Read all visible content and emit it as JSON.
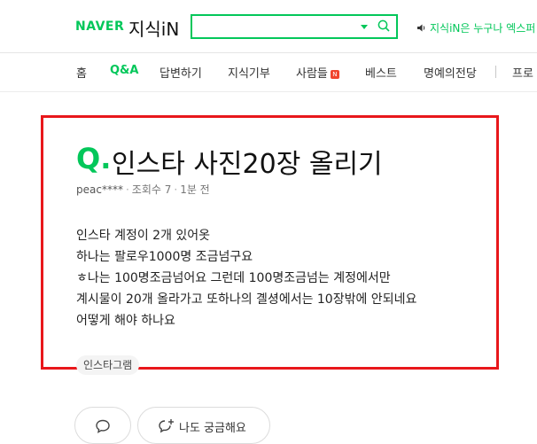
{
  "header": {
    "logo_brand": "NAVER",
    "logo_service": "지식iN",
    "search_placeholder": "",
    "notice_highlight": "지식iN은 누구나 엑스퍼",
    "notice_rest": "",
    "brand_color": "#03c75a"
  },
  "nav": {
    "items": [
      {
        "label": "홈"
      },
      {
        "label": "Q&A",
        "active": true
      },
      {
        "label": "답변하기"
      },
      {
        "label": "지식기부"
      },
      {
        "label": "사람들",
        "badge": "N"
      },
      {
        "label": "베스트"
      },
      {
        "label": "명예의전당"
      },
      {
        "label": "프로"
      }
    ]
  },
  "question": {
    "q_mark": "Q.",
    "title": "인스타 사진20장 올리기",
    "author": "peac****",
    "views": "조회수 7",
    "time": "1분 전",
    "body": [
      "인스타 계정이 2개 있어옷",
      "하나는 팔로우1000명 조금넘구요",
      "ㅎ나는 100명조금넘어요 그런데 100명조금넘는 계정에서만",
      "계시물이 20개 올라가고 또하나의 곌셩에서는 10장밖에 안되네요",
      "어떻게 해야 하나요"
    ],
    "tag": "인스타그램",
    "highlight_color": "#e8171b"
  },
  "actions": {
    "curious_label": "나도 궁금해요"
  }
}
